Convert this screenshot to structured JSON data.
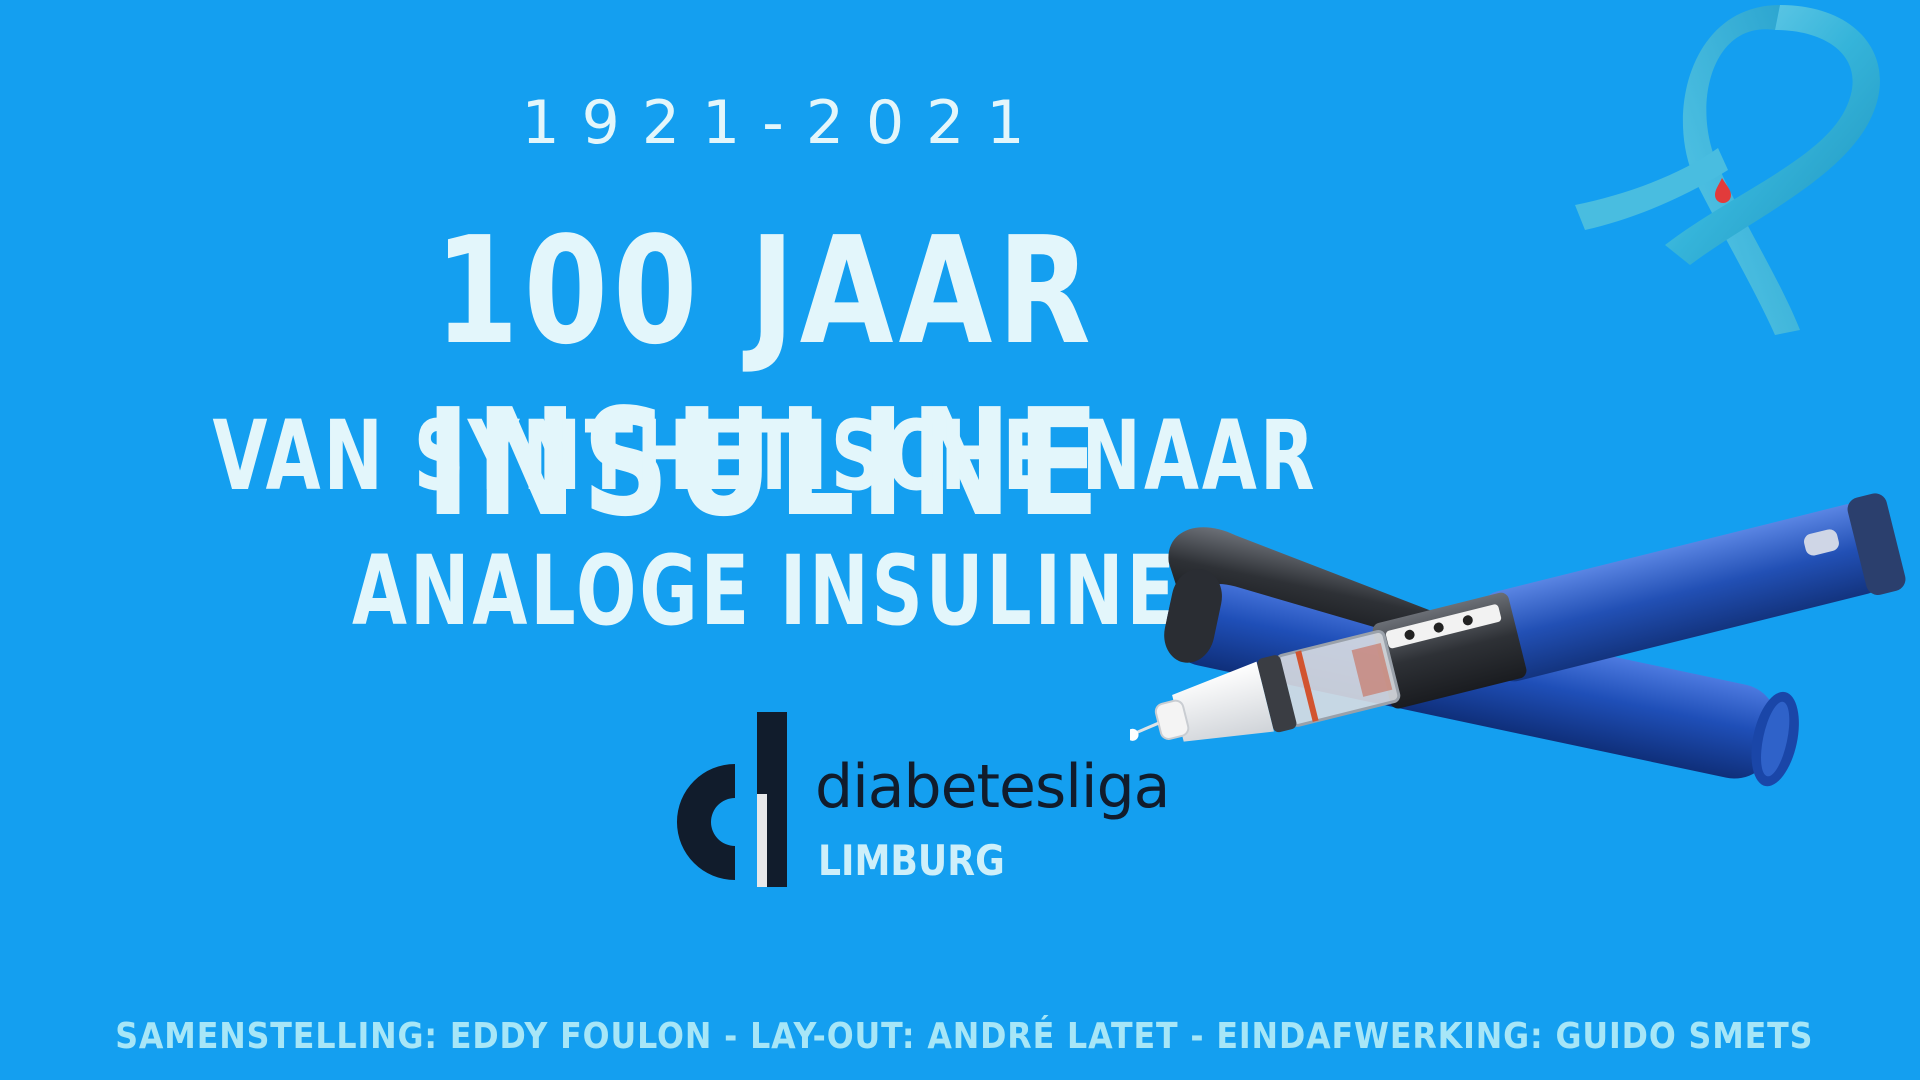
{
  "header": {
    "years": "1921-2021",
    "title": "100 JAAR INSULINE",
    "subtitle_line1": "VAN SYNTHETISCHE NAAR",
    "subtitle_line2": "ANALOGE INSULINE"
  },
  "logo": {
    "name": "diabetesliga",
    "region": "LIMBURG"
  },
  "footer": {
    "credits": "SAMENSTELLING: EDDY FOULON - LAY-OUT: ANDRÉ LATET - EINDAFWERKING: GUIDO SMETS"
  },
  "colors": {
    "background": "#149ff0",
    "text": "#e3f6fb",
    "credits_text": "#a7e6f7",
    "logo_dark": "#111c2c",
    "pen_blue": "#2a5fc4",
    "ribbon": "#4fc3e3"
  },
  "images": {
    "ribbon": "awareness-ribbon-icon",
    "pen": "insulin-pen-image"
  }
}
